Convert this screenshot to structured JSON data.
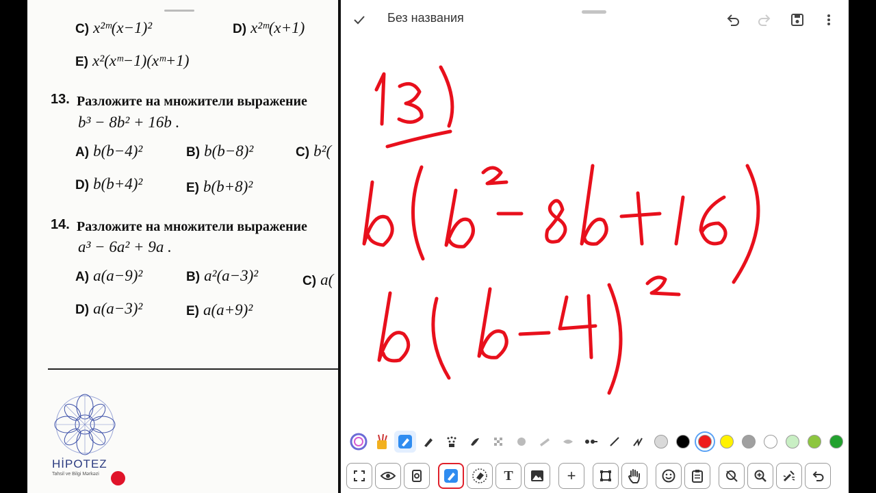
{
  "document": {
    "prev_options": {
      "c": {
        "label": "C)",
        "expr": "x²ᵐ(x−1)²"
      },
      "d": {
        "label": "D)",
        "expr": "x²ᵐ(x+1)"
      },
      "e": {
        "label": "E)",
        "expr": "x²(xᵐ−1)(xᵐ+1)"
      }
    },
    "q13": {
      "number": "13.",
      "text": "Разложите на множители выражение",
      "expr": "b³ − 8b² + 16b .",
      "options": [
        {
          "label": "A)",
          "expr": "b(b−4)²"
        },
        {
          "label": "B)",
          "expr": "b(b−8)²"
        },
        {
          "label": "C)",
          "expr": "b²("
        },
        {
          "label": "D)",
          "expr": "b(b+4)²"
        },
        {
          "label": "E)",
          "expr": "b(b+8)²"
        }
      ]
    },
    "q14": {
      "number": "14.",
      "text": "Разложите на множители выражение",
      "expr": "a³ − 6a² + 9a .",
      "options": [
        {
          "label": "A)",
          "expr": "a(a−9)²"
        },
        {
          "label": "B)",
          "expr": "a²(a−3)²"
        },
        {
          "label": "C)",
          "expr": "a("
        },
        {
          "label": "D)",
          "expr": "a(a−3)²"
        },
        {
          "label": "E)",
          "expr": "a(a+9)²"
        }
      ]
    },
    "logo": {
      "name": "HİPOTEZ",
      "tagline": "Tahsil ve Bilgi Mərkəzi"
    }
  },
  "whiteboard": {
    "title": "Без названия",
    "confirm_icon": "check-icon",
    "ink_color": "#e8101c",
    "handwriting": [
      "13)",
      "b(b²−8b+16)",
      "b(b−4)²"
    ]
  },
  "toolbar": {
    "colors": [
      "#d9d9d9",
      "#000000",
      "#ee1c1c",
      "#fff200",
      "#a0a0a0",
      "#ffffff",
      "#c9efc4",
      "#8dc63f",
      "#22a12e"
    ],
    "selected_color_index": 2,
    "row2_icons": [
      "fullscreen-icon",
      "eye-icon",
      "page-settings-icon",
      "pen-tool-icon",
      "eraser-icon",
      "text-tool-icon",
      "image-icon",
      "add-icon",
      "crop-icon",
      "hand-icon",
      "emoji-icon",
      "clipboard-icon",
      "no-lasso-icon",
      "zoom-in-icon",
      "clear-icon",
      "undo-icon"
    ],
    "text_tool_label": "T",
    "add_label": "+"
  }
}
